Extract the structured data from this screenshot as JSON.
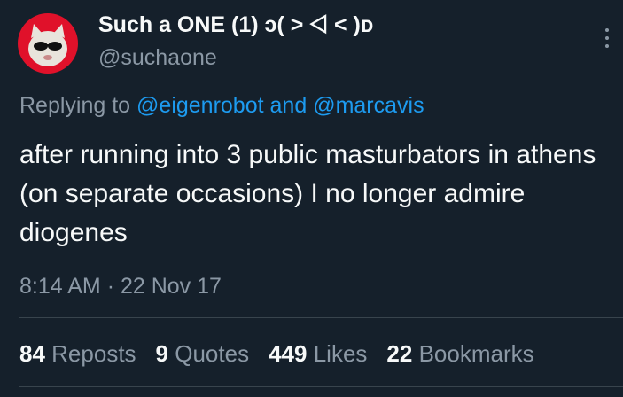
{
  "author": {
    "display_name": "Such a ONE (1) ɔ( ˃ ⨞ ˂ )ᴅ",
    "handle": "@suchaone",
    "avatar_icon": "cat-sunglasses-avatar"
  },
  "reply": {
    "prefix": "Replying to",
    "mention1": "@eigenrobot",
    "and": "and",
    "mention2": "@marcavis"
  },
  "tweet": {
    "text": "after running into 3 public masturbators in athens (on separate occasions) I no longer admire diogenes",
    "time": "8:14 AM",
    "separator": "·",
    "date": "22 Nov 17"
  },
  "stats": {
    "reposts": {
      "count": "84",
      "label": "Reposts"
    },
    "quotes": {
      "count": "9",
      "label": "Quotes"
    },
    "likes": {
      "count": "449",
      "label": "Likes"
    },
    "bookmarks": {
      "count": "22",
      "label": "Bookmarks"
    }
  },
  "colors": {
    "background": "#15202b",
    "link": "#1d9bf0",
    "secondary_text": "#8b98a5",
    "avatar_bg": "#e0112a"
  }
}
